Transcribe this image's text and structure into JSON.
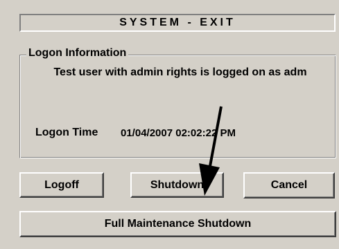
{
  "dialog": {
    "title": "SYSTEM - EXIT"
  },
  "logon_information": {
    "group_label": "Logon Information",
    "message": "Test user with admin rights is logged on as adm",
    "logon_time_label": "Logon Time",
    "logon_time_value": "01/04/2007 02:02:22 PM"
  },
  "buttons": {
    "logoff": "Logoff",
    "shutdown": "Shutdown",
    "cancel": "Cancel",
    "full_maintenance_shutdown": "Full Maintenance Shutdown"
  },
  "annotation": {
    "icon": "arrow-down-icon",
    "color": "#000000"
  },
  "colors": {
    "dialog_background": "#d4d0c8"
  }
}
